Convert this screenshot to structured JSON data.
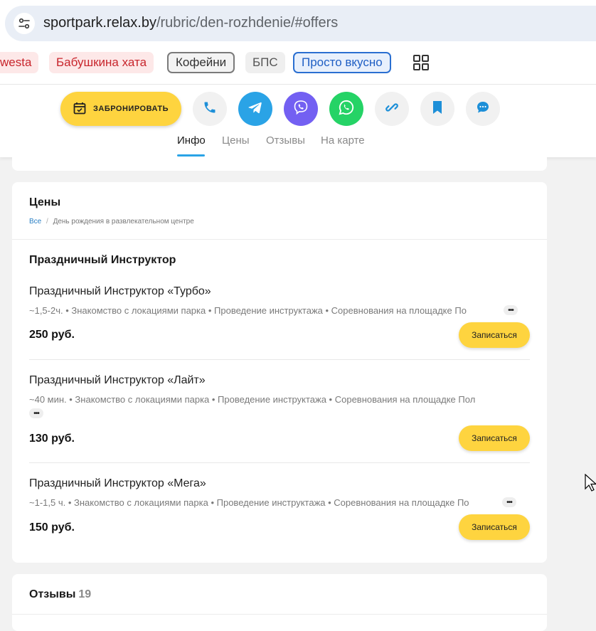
{
  "browser": {
    "url_host": "sportpark.relax.by",
    "url_path": "/rubric/den-rozhdenie/#offers"
  },
  "tags": [
    {
      "label": "westa"
    },
    {
      "label": "Бабушкина хата"
    },
    {
      "label": "Кофейни"
    },
    {
      "label": "БПС"
    },
    {
      "label": "Просто вкусно"
    }
  ],
  "actions": {
    "book_label": "ЗАБРОНИРОВАТЬ",
    "icons": [
      "phone-icon",
      "telegram-icon",
      "viber-icon",
      "whatsapp-icon",
      "link-icon",
      "bookmark-icon",
      "chat-icon"
    ],
    "colors": {
      "telegram": "#2aa3e6",
      "viber": "#7360f2",
      "whatsapp": "#25d366",
      "accent": "#2aa3e6",
      "button": "#fed43f"
    }
  },
  "nav": {
    "tabs": [
      {
        "label": "Инфо",
        "active": true
      },
      {
        "label": "Цены"
      },
      {
        "label": "Отзывы"
      },
      {
        "label": "На карте"
      }
    ]
  },
  "prices": {
    "title": "Цены",
    "breadcrumb": {
      "root": "Все",
      "separator": "/",
      "current": "День рождения в развлекательном центре"
    },
    "group_title": "Праздничный Инструктор",
    "offers": [
      {
        "name": "Праздничный Инструктор «Турбо»",
        "desc": "~1,5-2ч. • Знакомство с локациями парка • Проведение инструктажа • Соревнования на площадке По",
        "price": "250 руб.",
        "button": "Записаться"
      },
      {
        "name": "Праздничный Инструктор «Лайт»",
        "desc": "~40 мин. • Знакомство с локациями парка • Проведение инструктажа • Соревнования на площадке Пол",
        "price": "130 руб.",
        "button": "Записаться"
      },
      {
        "name": "Праздничный Инструктор «Мега»",
        "desc": "~1-1,5 ч. • Знакомство с локациями парка • Проведение инструктажа • Соревнования на площадке По",
        "price": "150 руб.",
        "button": "Записаться"
      }
    ],
    "more_glyph": "•••"
  },
  "reviews": {
    "title": "Отзывы",
    "count": "19"
  }
}
